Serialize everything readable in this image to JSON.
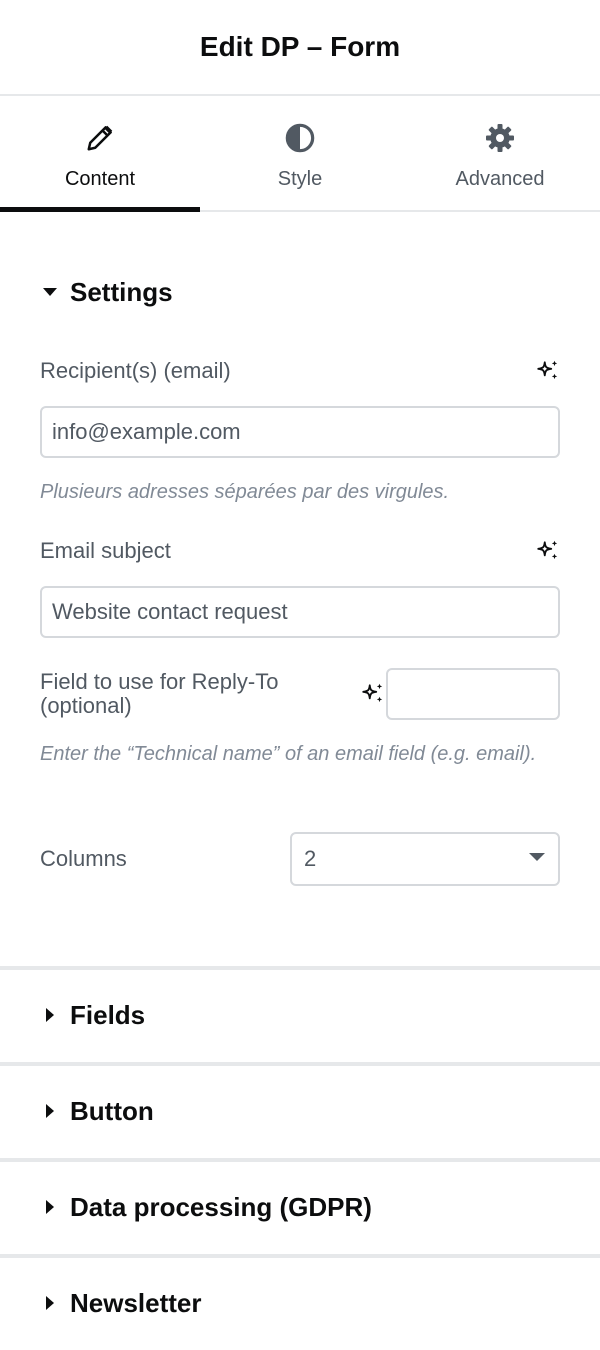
{
  "header": {
    "title": "Edit DP – Form"
  },
  "tabs": [
    {
      "label": "Content",
      "icon": "pencil-icon",
      "active": true
    },
    {
      "label": "Style",
      "icon": "contrast-icon",
      "active": false
    },
    {
      "label": "Advanced",
      "icon": "gear-icon",
      "active": false
    }
  ],
  "settings": {
    "title": "Settings",
    "recipients": {
      "label": "Recipient(s) (email)",
      "value": "info@example.com",
      "help": "Plusieurs adresses séparées par des virgules."
    },
    "subject": {
      "label": "Email subject",
      "value": "Website contact request"
    },
    "reply_to": {
      "label_line1": "Field to use for Reply-To",
      "label_line2": "(optional)",
      "value": "",
      "help": "Enter the “Technical name” of an email field (e.g. email)."
    },
    "columns": {
      "label": "Columns",
      "value": "2"
    }
  },
  "sections": [
    {
      "label": "Fields"
    },
    {
      "label": "Button"
    },
    {
      "label": "Data processing (GDPR)"
    },
    {
      "label": "Newsletter"
    }
  ],
  "colors": {
    "text_dark": "#0c0d0e",
    "text_muted": "#515962",
    "help_text": "#818a96",
    "border": "#d5d8dc",
    "divider": "#e6e8ea"
  },
  "icons": {
    "sparkle": "ai-sparkle-icon",
    "caret_down": "caret-down-icon",
    "caret_right": "caret-right-icon",
    "select_arrow": "chevron-down-icon"
  }
}
